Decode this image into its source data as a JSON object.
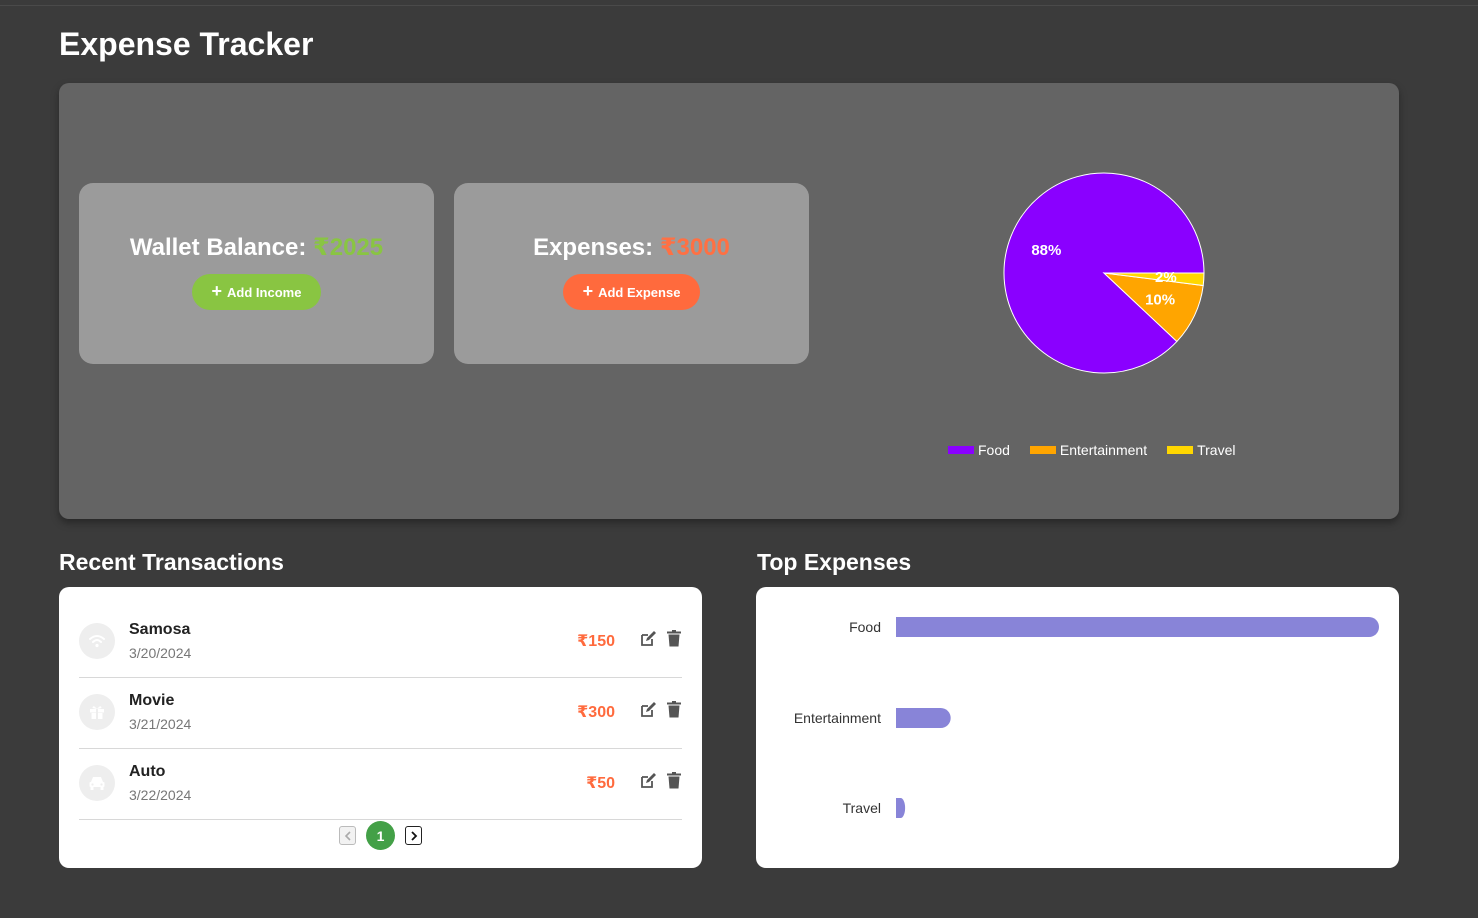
{
  "app": {
    "title": "Expense Tracker"
  },
  "wallet": {
    "label": "Wallet Balance: ",
    "amount": "₹2025",
    "button_label": "Add Income"
  },
  "expenses": {
    "label": "Expenses: ",
    "amount": "₹3000",
    "button_label": "Add Expense"
  },
  "colors": {
    "food": "#8a00ff",
    "entertainment": "#ffa500",
    "travel": "#ffd700",
    "bar": "#8884d8",
    "income": "#89c542",
    "expense": "#ff6a3d"
  },
  "recent": {
    "title": "Recent Transactions",
    "items": [
      {
        "name": "Samosa",
        "date": "3/20/2024",
        "amount": "₹150",
        "icon": "food-icon"
      },
      {
        "name": "Movie",
        "date": "3/21/2024",
        "amount": "₹300",
        "icon": "gift-icon"
      },
      {
        "name": "Auto",
        "date": "3/22/2024",
        "amount": "₹50",
        "icon": "car-icon"
      }
    ],
    "pagination": {
      "current": "1"
    }
  },
  "top": {
    "title": "Top Expenses"
  },
  "chart_data": [
    {
      "type": "pie",
      "categories": [
        "Food",
        "Entertainment",
        "Travel"
      ],
      "values": [
        88,
        10,
        2
      ],
      "labels": [
        "88%",
        "10%",
        "2%"
      ],
      "legend_placement": "bottom"
    },
    {
      "type": "bar",
      "orientation": "horizontal",
      "categories": [
        "Food",
        "Entertainment",
        "Travel"
      ],
      "values": [
        2650,
        300,
        50
      ]
    }
  ]
}
